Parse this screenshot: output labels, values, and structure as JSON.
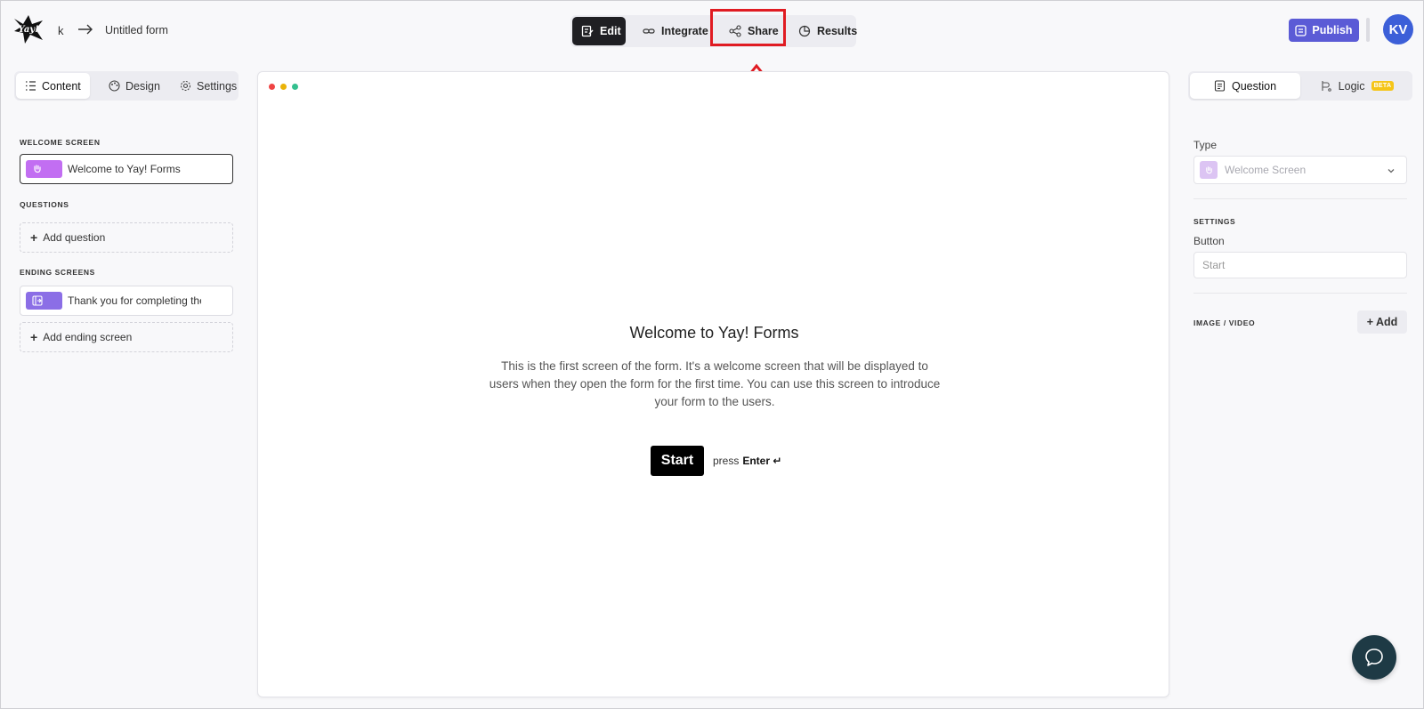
{
  "header": {
    "workspace": "k",
    "form_name": "Untitled form",
    "tabs": [
      {
        "label": "Edit",
        "icon": "edit-icon",
        "active": true
      },
      {
        "label": "Integrate",
        "icon": "link-icon",
        "active": false
      },
      {
        "label": "Share",
        "icon": "share-icon",
        "active": false
      },
      {
        "label": "Results",
        "icon": "pie-chart-icon",
        "active": false
      }
    ],
    "publish_label": "Publish",
    "avatar_initials": "KV"
  },
  "left_panel": {
    "tabs": [
      {
        "label": "Content",
        "icon": "list-icon",
        "active": true
      },
      {
        "label": "Design",
        "icon": "palette-icon",
        "active": false
      },
      {
        "label": "Settings",
        "icon": "gear-icon",
        "active": false
      }
    ],
    "welcome_section": "WELCOME SCREEN",
    "welcome_item": "Welcome to Yay! Forms",
    "questions_section": "QUESTIONS",
    "add_question": "Add question",
    "ending_section": "ENDING SCREENS",
    "ending_item": "Thank you for completing the form",
    "add_ending": "Add ending screen"
  },
  "preview": {
    "title": "Welcome to Yay! Forms",
    "description": "This is the first screen of the form. It's a welcome screen that will be displayed to users when they open the form for the first time. You can use this screen to introduce your form to the users.",
    "start_label": "Start",
    "press_label": "press",
    "enter_label": "Enter ↵"
  },
  "right_panel": {
    "tabs": [
      {
        "label": "Question",
        "icon": "document-icon",
        "active": true
      },
      {
        "label": "Logic",
        "icon": "logic-icon",
        "active": false,
        "badge": "BETA"
      }
    ],
    "type_label": "Type",
    "type_value": "Welcome Screen",
    "settings_section": "SETTINGS",
    "button_label": "Button",
    "button_placeholder": "Start",
    "media_section": "IMAGE / VIDEO",
    "add_media": "+ Add"
  },
  "colors": {
    "accent_purple": "#5b5bd6",
    "welcome_badge": "#c26ef2",
    "ending_badge": "#8b6ee6",
    "highlight_red": "#e01b22",
    "avatar_blue": "#3c5fd8",
    "chat_bubble": "#1e3a45"
  }
}
